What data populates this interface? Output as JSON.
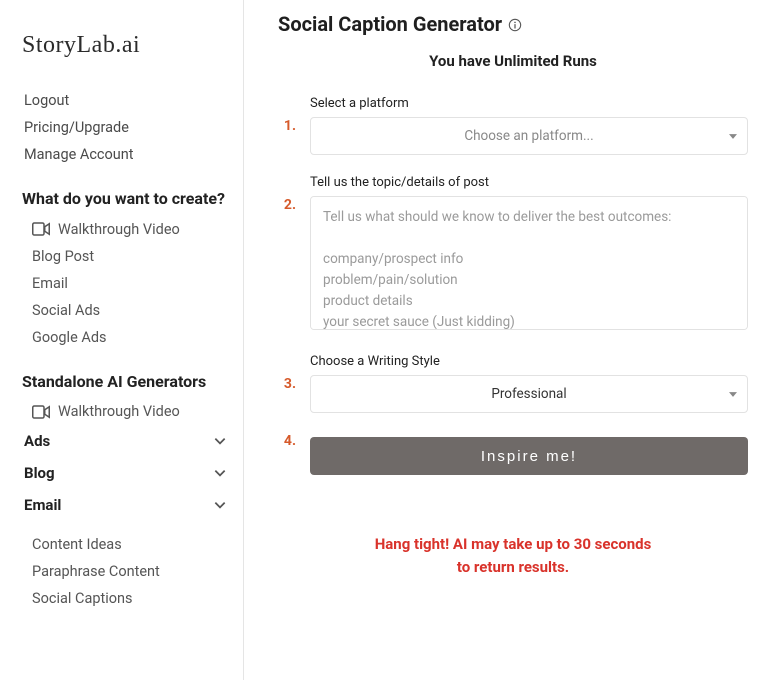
{
  "brand": "StoryLab.ai",
  "sidebar": {
    "top_links": [
      {
        "label": "Logout",
        "name": "logout-link"
      },
      {
        "label": "Pricing/Upgrade",
        "name": "pricing-link"
      },
      {
        "label": "Manage Account",
        "name": "manage-account-link"
      }
    ],
    "create_heading": "What do you want to create?",
    "create_items": [
      {
        "label": "Walkthrough Video",
        "name": "sidebar-item-walkthrough-video",
        "icon": "video-icon"
      },
      {
        "label": "Blog Post",
        "name": "sidebar-item-blog-post"
      },
      {
        "label": "Email",
        "name": "sidebar-item-email"
      },
      {
        "label": "Social Ads",
        "name": "sidebar-item-social-ads"
      },
      {
        "label": "Google Ads",
        "name": "sidebar-item-google-ads"
      }
    ],
    "standalone_heading": "Standalone AI Generators",
    "standalone_items": [
      {
        "label": "Walkthrough Video",
        "name": "sidebar-item-standalone-walkthrough",
        "icon": "video-icon"
      }
    ],
    "accordions": [
      {
        "label": "Ads",
        "name": "accordion-ads"
      },
      {
        "label": "Blog",
        "name": "accordion-blog"
      },
      {
        "label": "Email",
        "name": "accordion-email"
      }
    ],
    "bottom_items": [
      {
        "label": "Content Ideas",
        "name": "sidebar-item-content-ideas"
      },
      {
        "label": "Paraphrase Content",
        "name": "sidebar-item-paraphrase-content"
      },
      {
        "label": "Social Captions",
        "name": "sidebar-item-social-captions"
      }
    ]
  },
  "main": {
    "title": "Social Caption Generator",
    "runs_text": "You have Unlimited Runs",
    "steps": {
      "s1": {
        "num": "1.",
        "label": "Select a platform",
        "placeholder": "Choose an platform..."
      },
      "s2": {
        "num": "2.",
        "label": "Tell us the topic/details of post",
        "placeholder": "Tell us what should we know to deliver the best outcomes:\n\ncompany/prospect info\nproblem/pain/solution\nproduct details\nyour secret sauce (Just kidding)"
      },
      "s3": {
        "num": "3.",
        "label": "Choose a Writing Style",
        "value": "Professional"
      },
      "s4": {
        "num": "4.",
        "cta": "Inspire me!"
      }
    },
    "wait_line1": "Hang tight! AI may take up to 30 seconds",
    "wait_line2": "to return results."
  }
}
